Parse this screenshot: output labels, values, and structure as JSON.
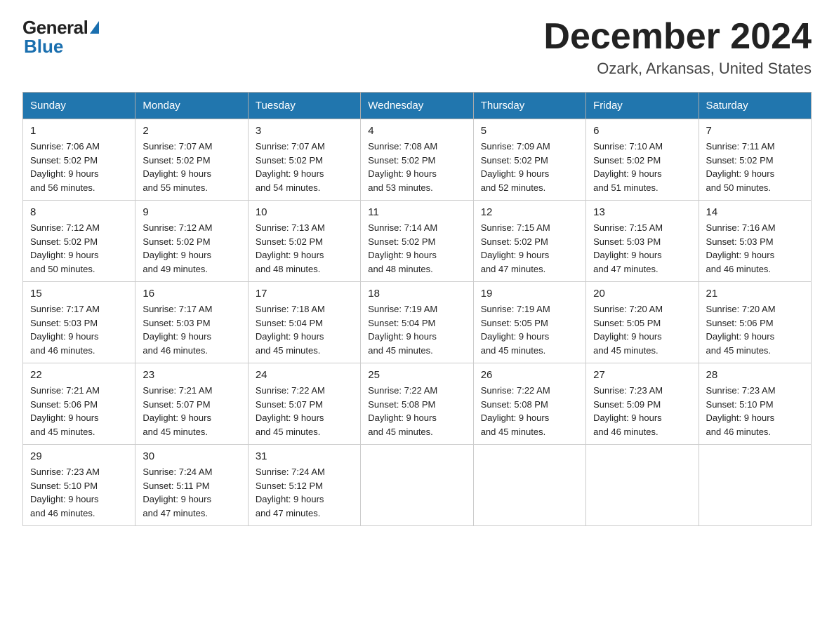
{
  "logo": {
    "general": "General",
    "blue": "Blue"
  },
  "title": "December 2024",
  "location": "Ozark, Arkansas, United States",
  "weekdays": [
    "Sunday",
    "Monday",
    "Tuesday",
    "Wednesday",
    "Thursday",
    "Friday",
    "Saturday"
  ],
  "weeks": [
    [
      {
        "day": "1",
        "sunrise": "7:06 AM",
        "sunset": "5:02 PM",
        "daylight": "9 hours and 56 minutes."
      },
      {
        "day": "2",
        "sunrise": "7:07 AM",
        "sunset": "5:02 PM",
        "daylight": "9 hours and 55 minutes."
      },
      {
        "day": "3",
        "sunrise": "7:07 AM",
        "sunset": "5:02 PM",
        "daylight": "9 hours and 54 minutes."
      },
      {
        "day": "4",
        "sunrise": "7:08 AM",
        "sunset": "5:02 PM",
        "daylight": "9 hours and 53 minutes."
      },
      {
        "day": "5",
        "sunrise": "7:09 AM",
        "sunset": "5:02 PM",
        "daylight": "9 hours and 52 minutes."
      },
      {
        "day": "6",
        "sunrise": "7:10 AM",
        "sunset": "5:02 PM",
        "daylight": "9 hours and 51 minutes."
      },
      {
        "day": "7",
        "sunrise": "7:11 AM",
        "sunset": "5:02 PM",
        "daylight": "9 hours and 50 minutes."
      }
    ],
    [
      {
        "day": "8",
        "sunrise": "7:12 AM",
        "sunset": "5:02 PM",
        "daylight": "9 hours and 50 minutes."
      },
      {
        "day": "9",
        "sunrise": "7:12 AM",
        "sunset": "5:02 PM",
        "daylight": "9 hours and 49 minutes."
      },
      {
        "day": "10",
        "sunrise": "7:13 AM",
        "sunset": "5:02 PM",
        "daylight": "9 hours and 48 minutes."
      },
      {
        "day": "11",
        "sunrise": "7:14 AM",
        "sunset": "5:02 PM",
        "daylight": "9 hours and 48 minutes."
      },
      {
        "day": "12",
        "sunrise": "7:15 AM",
        "sunset": "5:02 PM",
        "daylight": "9 hours and 47 minutes."
      },
      {
        "day": "13",
        "sunrise": "7:15 AM",
        "sunset": "5:03 PM",
        "daylight": "9 hours and 47 minutes."
      },
      {
        "day": "14",
        "sunrise": "7:16 AM",
        "sunset": "5:03 PM",
        "daylight": "9 hours and 46 minutes."
      }
    ],
    [
      {
        "day": "15",
        "sunrise": "7:17 AM",
        "sunset": "5:03 PM",
        "daylight": "9 hours and 46 minutes."
      },
      {
        "day": "16",
        "sunrise": "7:17 AM",
        "sunset": "5:03 PM",
        "daylight": "9 hours and 46 minutes."
      },
      {
        "day": "17",
        "sunrise": "7:18 AM",
        "sunset": "5:04 PM",
        "daylight": "9 hours and 45 minutes."
      },
      {
        "day": "18",
        "sunrise": "7:19 AM",
        "sunset": "5:04 PM",
        "daylight": "9 hours and 45 minutes."
      },
      {
        "day": "19",
        "sunrise": "7:19 AM",
        "sunset": "5:05 PM",
        "daylight": "9 hours and 45 minutes."
      },
      {
        "day": "20",
        "sunrise": "7:20 AM",
        "sunset": "5:05 PM",
        "daylight": "9 hours and 45 minutes."
      },
      {
        "day": "21",
        "sunrise": "7:20 AM",
        "sunset": "5:06 PM",
        "daylight": "9 hours and 45 minutes."
      }
    ],
    [
      {
        "day": "22",
        "sunrise": "7:21 AM",
        "sunset": "5:06 PM",
        "daylight": "9 hours and 45 minutes."
      },
      {
        "day": "23",
        "sunrise": "7:21 AM",
        "sunset": "5:07 PM",
        "daylight": "9 hours and 45 minutes."
      },
      {
        "day": "24",
        "sunrise": "7:22 AM",
        "sunset": "5:07 PM",
        "daylight": "9 hours and 45 minutes."
      },
      {
        "day": "25",
        "sunrise": "7:22 AM",
        "sunset": "5:08 PM",
        "daylight": "9 hours and 45 minutes."
      },
      {
        "day": "26",
        "sunrise": "7:22 AM",
        "sunset": "5:08 PM",
        "daylight": "9 hours and 45 minutes."
      },
      {
        "day": "27",
        "sunrise": "7:23 AM",
        "sunset": "5:09 PM",
        "daylight": "9 hours and 46 minutes."
      },
      {
        "day": "28",
        "sunrise": "7:23 AM",
        "sunset": "5:10 PM",
        "daylight": "9 hours and 46 minutes."
      }
    ],
    [
      {
        "day": "29",
        "sunrise": "7:23 AM",
        "sunset": "5:10 PM",
        "daylight": "9 hours and 46 minutes."
      },
      {
        "day": "30",
        "sunrise": "7:24 AM",
        "sunset": "5:11 PM",
        "daylight": "9 hours and 47 minutes."
      },
      {
        "day": "31",
        "sunrise": "7:24 AM",
        "sunset": "5:12 PM",
        "daylight": "9 hours and 47 minutes."
      },
      null,
      null,
      null,
      null
    ]
  ],
  "labels": {
    "sunrise": "Sunrise:",
    "sunset": "Sunset:",
    "daylight": "Daylight:"
  }
}
